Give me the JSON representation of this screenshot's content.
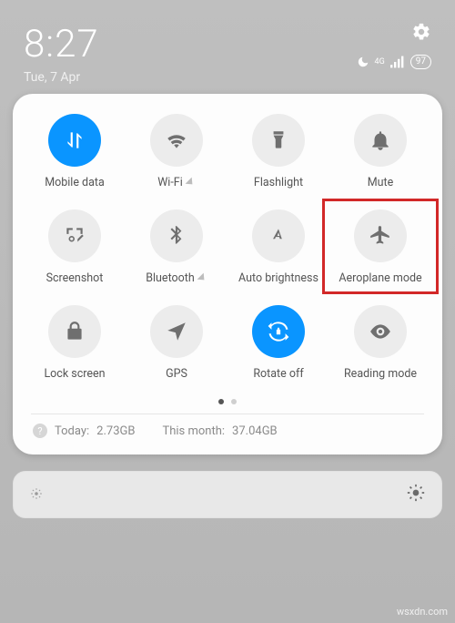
{
  "status": {
    "time": "8:27",
    "date": "Tue, 7 Apr",
    "network": "4G",
    "battery": "97"
  },
  "tiles": {
    "mobile_data": "Mobile data",
    "wifi": "Wi-Fi",
    "flashlight": "Flashlight",
    "mute": "Mute",
    "screenshot": "Screenshot",
    "bluetooth": "Bluetooth",
    "auto_brightness": "Auto brightness",
    "aeroplane": "Aeroplane mode",
    "lock_screen": "Lock screen",
    "gps": "GPS",
    "rotate_off": "Rotate off",
    "reading_mode": "Reading mode"
  },
  "usage": {
    "today_label": "Today:",
    "today_value": "2.73GB",
    "month_label": "This month:",
    "month_value": "37.04GB"
  },
  "watermark": "wsxdn.com"
}
